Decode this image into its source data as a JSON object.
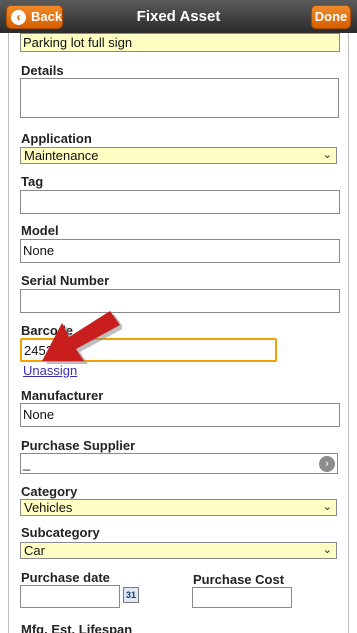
{
  "header": {
    "title": "Fixed Asset",
    "back_label": "Back",
    "done_label": "Done",
    "accent_color": "#e8761a"
  },
  "form": {
    "name_value": "Parking lot full sign",
    "details_label": "Details",
    "details_value": "",
    "application_label": "Application",
    "application_value": "Maintenance",
    "tag_label": "Tag",
    "tag_value": "",
    "model_label": "Model",
    "model_value": "None",
    "serial_label": "Serial Number",
    "serial_value": "",
    "barcode_label": "Barcode",
    "barcode_value": "245217",
    "unassign_label": "Unassign",
    "manufacturer_label": "Manufacturer",
    "manufacturer_value": "None",
    "purchase_supplier_label": "Purchase Supplier",
    "purchase_supplier_value": "_",
    "category_label": "Category",
    "category_value": "Vehicles",
    "subcategory_label": "Subcategory",
    "subcategory_value": "Car",
    "purchase_date_label": "Purchase date",
    "purchase_date_value": "",
    "calendar_day": "31",
    "purchase_cost_label": "Purchase Cost",
    "purchase_cost_value": "",
    "mfg_lifespan_label": "Mfg. Est. Lifespan"
  }
}
